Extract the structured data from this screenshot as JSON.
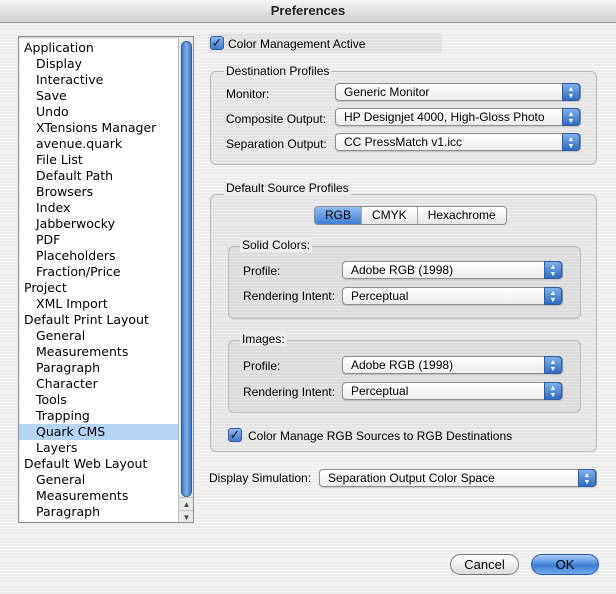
{
  "window": {
    "title": "Preferences"
  },
  "sidebar": {
    "items": [
      {
        "label": "Application",
        "level": 0
      },
      {
        "label": "Display",
        "level": 1
      },
      {
        "label": "Interactive",
        "level": 1
      },
      {
        "label": "Save",
        "level": 1
      },
      {
        "label": "Undo",
        "level": 1
      },
      {
        "label": "XTensions Manager",
        "level": 1
      },
      {
        "label": "avenue.quark",
        "level": 1
      },
      {
        "label": "File List",
        "level": 1
      },
      {
        "label": "Default Path",
        "level": 1
      },
      {
        "label": "Browsers",
        "level": 1
      },
      {
        "label": "Index",
        "level": 1
      },
      {
        "label": "Jabberwocky",
        "level": 1
      },
      {
        "label": "PDF",
        "level": 1
      },
      {
        "label": "Placeholders",
        "level": 1
      },
      {
        "label": "Fraction/Price",
        "level": 1
      },
      {
        "label": "Project",
        "level": 0
      },
      {
        "label": "XML Import",
        "level": 1
      },
      {
        "label": "Default Print Layout",
        "level": 0
      },
      {
        "label": "General",
        "level": 1
      },
      {
        "label": "Measurements",
        "level": 1
      },
      {
        "label": "Paragraph",
        "level": 1
      },
      {
        "label": "Character",
        "level": 1
      },
      {
        "label": "Tools",
        "level": 1
      },
      {
        "label": "Trapping",
        "level": 1
      },
      {
        "label": "Quark CMS",
        "level": 1,
        "selected": true
      },
      {
        "label": "Layers",
        "level": 1
      },
      {
        "label": "Default Web Layout",
        "level": 0
      },
      {
        "label": "General",
        "level": 1
      },
      {
        "label": "Measurements",
        "level": 1
      },
      {
        "label": "Paragraph",
        "level": 1
      }
    ],
    "scroll_up_icon": "triangle-up",
    "scroll_down_icon": "triangle-down"
  },
  "color_management": {
    "label": "Color Management Active",
    "checked": true
  },
  "destination": {
    "title": "Destination Profiles",
    "monitor_label": "Monitor:",
    "monitor_value": "Generic Monitor",
    "composite_label": "Composite Output:",
    "composite_value": "HP Designjet 4000, High-Gloss Photo",
    "separation_label": "Separation Output:",
    "separation_value": "CC PressMatch v1.icc"
  },
  "source": {
    "title": "Default Source Profiles",
    "tabs": [
      "RGB",
      "CMYK",
      "Hexachrome"
    ],
    "active_tab": "RGB",
    "solid": {
      "title": "Solid Colors:",
      "profile_label": "Profile:",
      "profile_value": "Adobe RGB (1998)",
      "intent_label": "Rendering Intent:",
      "intent_value": "Perceptual"
    },
    "images": {
      "title": "Images:",
      "profile_label": "Profile:",
      "profile_value": "Adobe RGB (1998)",
      "intent_label": "Rendering Intent:",
      "intent_value": "Perceptual"
    },
    "rgb_to_rgb": {
      "label": "Color Manage RGB Sources to RGB Destinations",
      "checked": true
    }
  },
  "display_simulation": {
    "label": "Display Simulation:",
    "value": "Separation Output Color Space"
  },
  "buttons": {
    "cancel": "Cancel",
    "ok": "OK"
  },
  "colors": {
    "accent": "#3f7fd6",
    "selection": "#b5d3f3"
  }
}
